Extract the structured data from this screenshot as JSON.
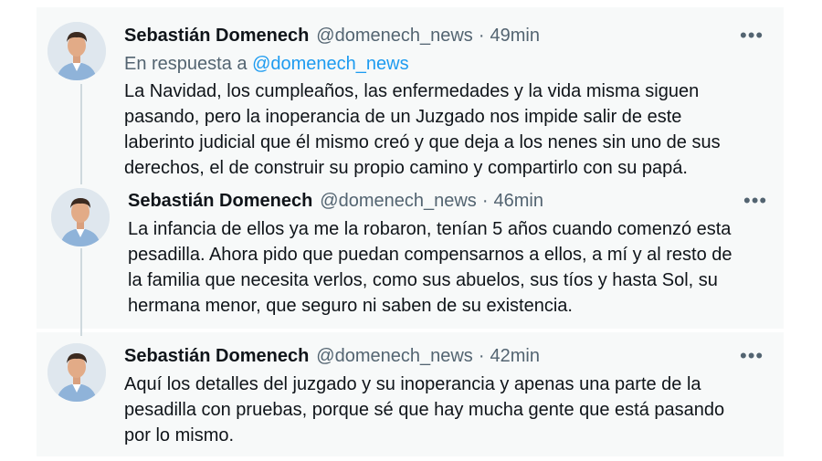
{
  "tweets": [
    {
      "author_name": "Sebastián Domenech",
      "handle": "@domenech_news",
      "separator": "·",
      "time": "49min",
      "more": "•••",
      "reply_prefix": "En respuesta a",
      "reply_mention": "@domenech_news",
      "lines": [
        "La Navidad, los cumpleaños, las enfermedades y la vida misma siguen",
        "pasando, pero la inoperancia de un Juzgado nos impide salir de este",
        "laberinto judicial que él mismo creó y que deja a los nenes sin uno de sus",
        "derechos, el de construir su propio camino y compartirlo con su papá."
      ]
    },
    {
      "author_name": "Sebastián Domenech",
      "handle": "@domenech_news",
      "separator": "·",
      "time": "46min",
      "more": "•••",
      "lines": [
        "La infancia de ellos ya me la robaron, tenían 5 años cuando comenzó esta",
        "pesadilla. Ahora pido que puedan compensarnos a ellos, a mí y al resto de",
        "la familia  que necesita verlos, como sus abuelos, sus tíos y hasta Sol, su",
        "hermana menor, que seguro ni saben de su existencia."
      ]
    },
    {
      "author_name": "Sebastián Domenech",
      "handle": "@domenech_news",
      "separator": "·",
      "time": "42min",
      "more": "•••",
      "lines": [
        "Aquí los detalles del juzgado y su inoperancia y apenas una parte de la",
        "pesadilla con pruebas, porque sé que hay mucha gente que está pasando",
        "por lo mismo."
      ]
    }
  ],
  "colors": {
    "background": "#f7f9f9",
    "text": "#0f1419",
    "secondary_text": "#536471",
    "link": "#1d9bf0",
    "thread_line": "#cfd9de"
  }
}
